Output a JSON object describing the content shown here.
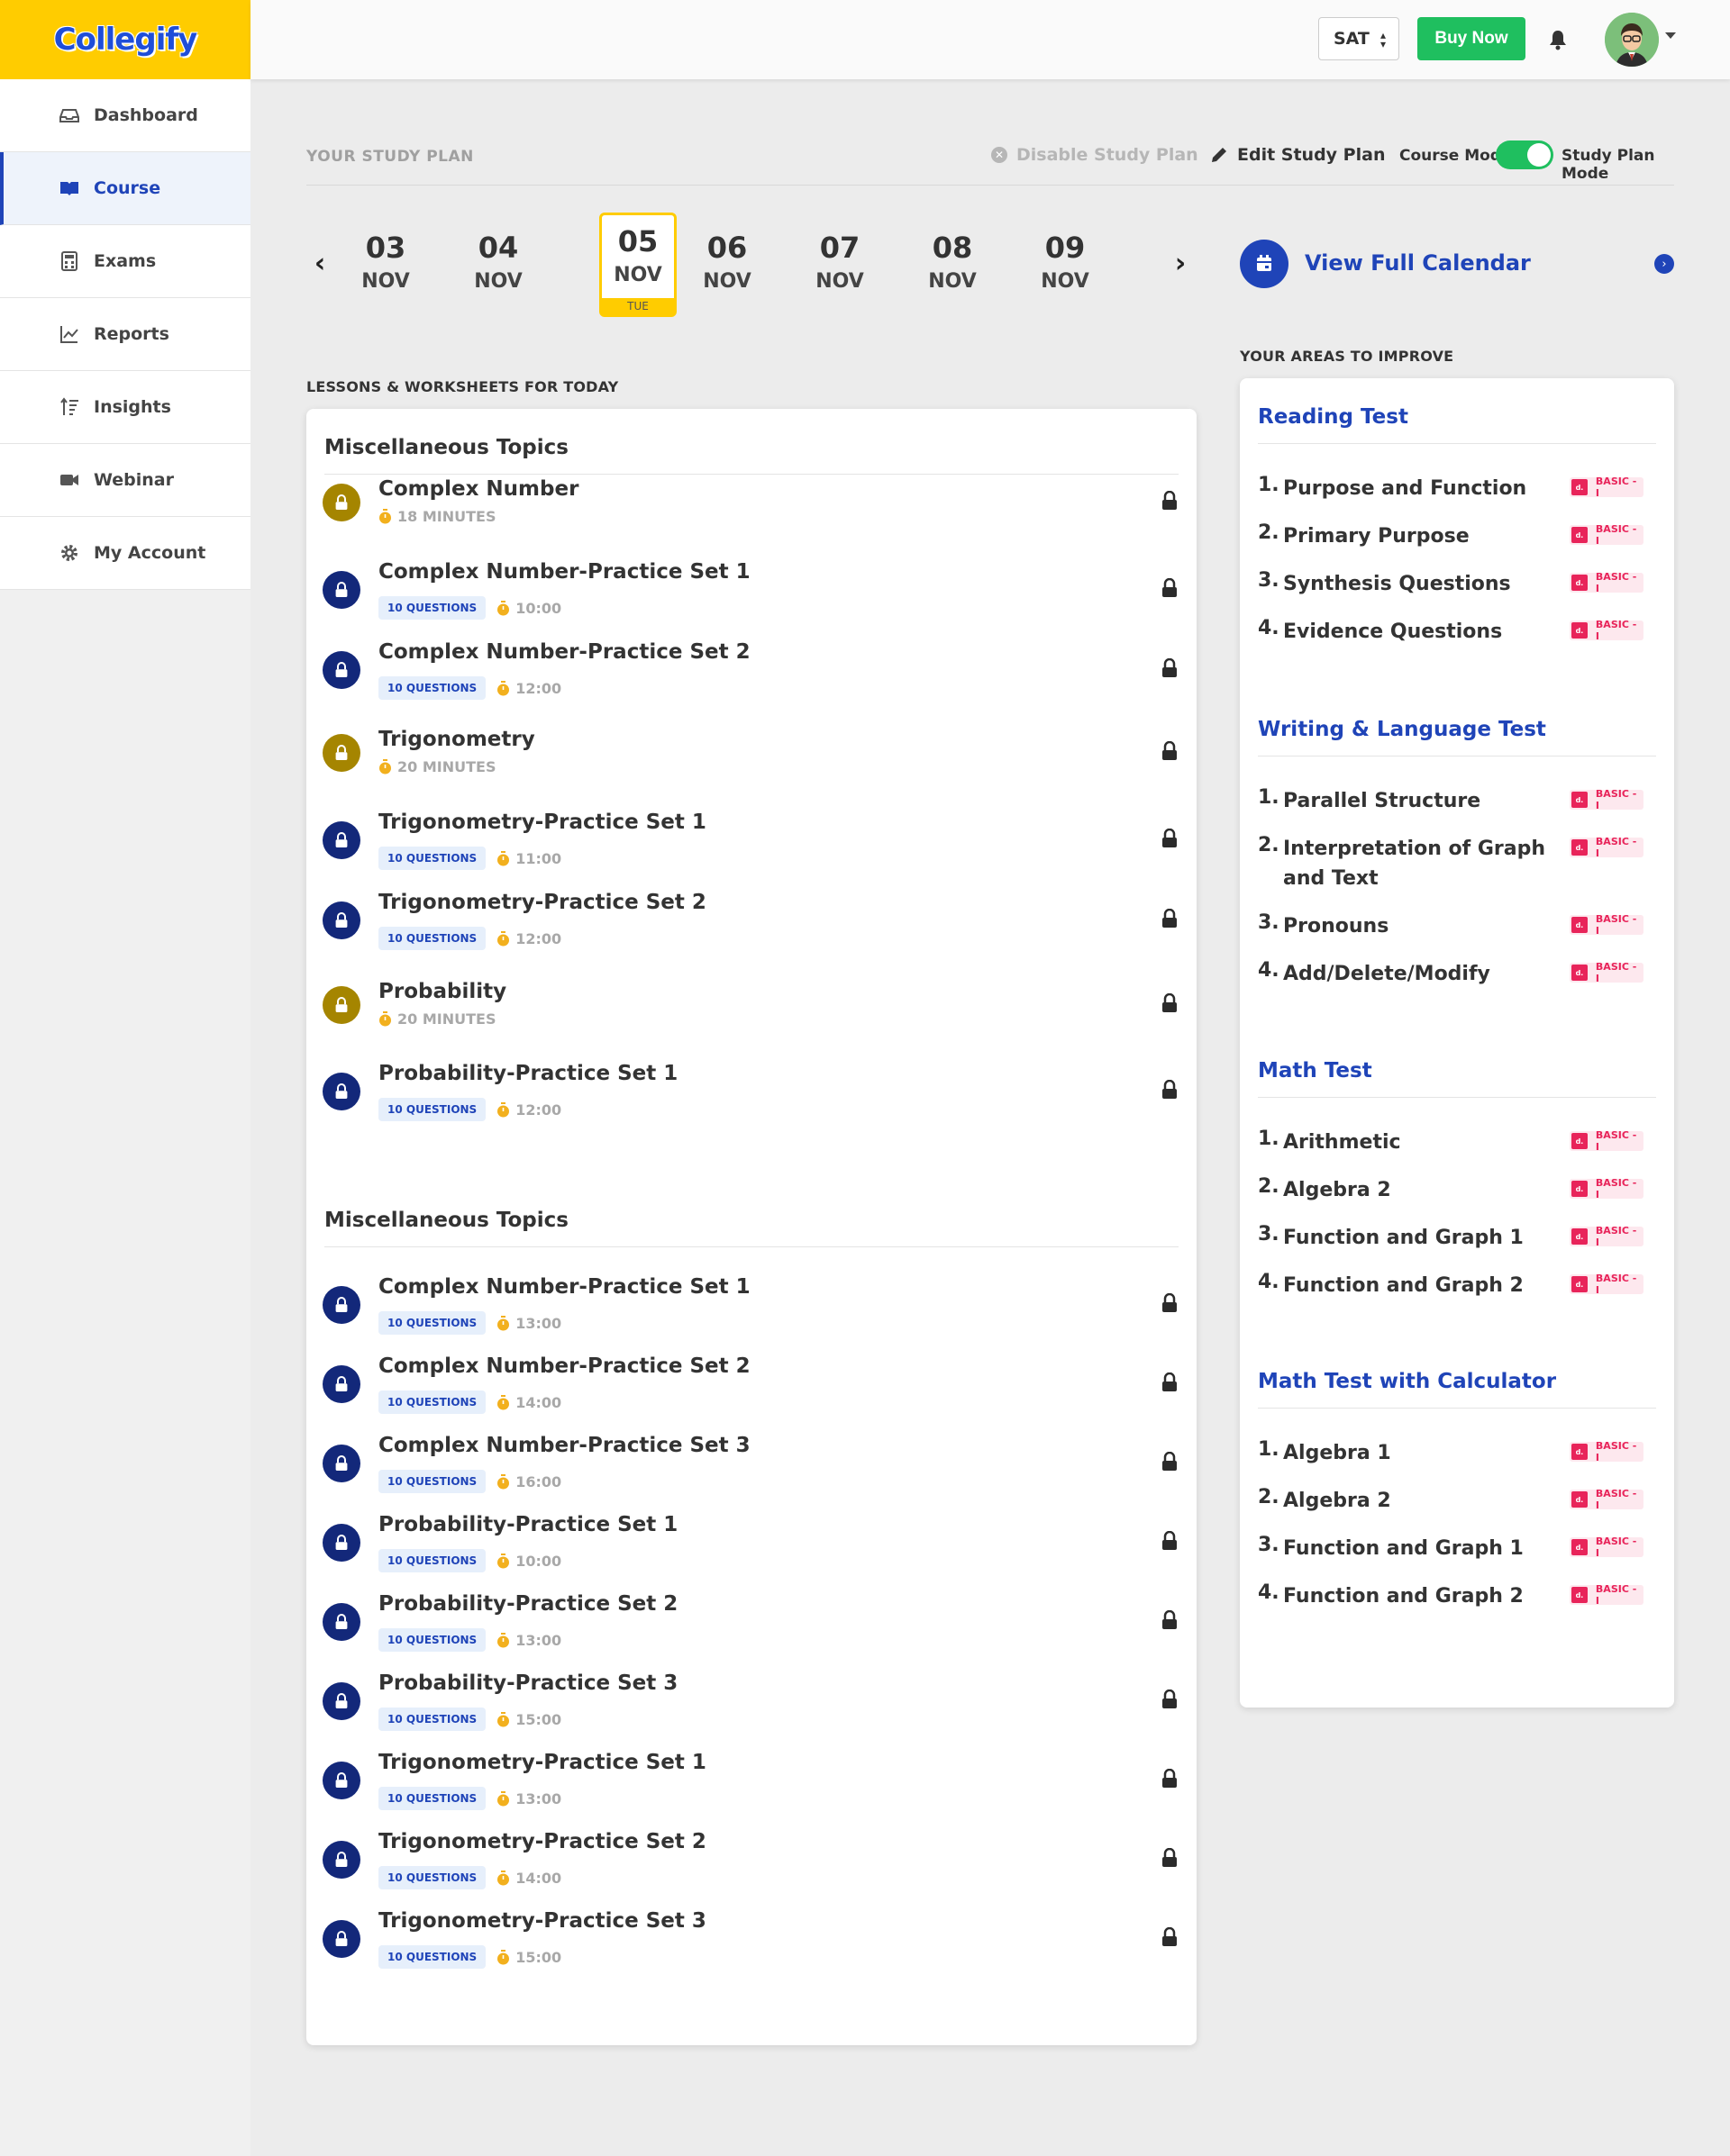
{
  "app": {
    "logo": "Collegify"
  },
  "sidebar": {
    "items": [
      {
        "label": "Dashboard",
        "icon": "inbox-icon"
      },
      {
        "label": "Course",
        "icon": "book-open-icon",
        "active": true
      },
      {
        "label": "Exams",
        "icon": "calculator-icon"
      },
      {
        "label": "Reports",
        "icon": "line-chart-icon"
      },
      {
        "label": "Insights",
        "icon": "sort-icon"
      },
      {
        "label": "Webinar",
        "icon": "video-camera-icon"
      },
      {
        "label": "My Account",
        "icon": "gear-icon"
      }
    ]
  },
  "topbar": {
    "exam_select": "SAT",
    "buy_label": "Buy Now",
    "bell_icon": "bell-icon",
    "avatar_icon": "avatar-icon"
  },
  "study_plan": {
    "title": "YOUR STUDY PLAN",
    "disable_label": "Disable Study Plan",
    "edit_label": "Edit Study Plan",
    "course_mode": "Course Mode",
    "plan_mode": "Study Plan Mode",
    "mode_on": true,
    "dates": [
      {
        "day": "03",
        "month": "NOV"
      },
      {
        "day": "04",
        "month": "NOV"
      },
      {
        "day": "05",
        "month": "NOV",
        "weekday": "TUE",
        "selected": true
      },
      {
        "day": "06",
        "month": "NOV"
      },
      {
        "day": "07",
        "month": "NOV"
      },
      {
        "day": "08",
        "month": "NOV"
      },
      {
        "day": "09",
        "month": "NOV"
      }
    ],
    "view_calendar": "View Full Calendar"
  },
  "lessons": {
    "section_label": "LESSONS & WORKSHEETS FOR TODAY",
    "groups": [
      {
        "title": "Miscellaneous Topics",
        "items": [
          {
            "title": "Complex Number",
            "type": "lesson",
            "time": "18 MINUTES"
          },
          {
            "title": "Complex Number-Practice Set 1",
            "type": "practice",
            "questions": "10 QUESTIONS",
            "time": "10:00"
          },
          {
            "title": "Complex Number-Practice Set 2",
            "type": "practice",
            "questions": "10 QUESTIONS",
            "time": "12:00"
          },
          {
            "title": "Trigonometry",
            "type": "lesson",
            "time": "20 MINUTES"
          },
          {
            "title": "Trigonometry-Practice Set 1",
            "type": "practice",
            "questions": "10 QUESTIONS",
            "time": "11:00"
          },
          {
            "title": "Trigonometry-Practice Set 2",
            "type": "practice",
            "questions": "10 QUESTIONS",
            "time": "12:00"
          },
          {
            "title": "Probability",
            "type": "lesson",
            "time": "20 MINUTES"
          },
          {
            "title": "Probability-Practice Set 1",
            "type": "practice",
            "questions": "10 QUESTIONS",
            "time": "12:00"
          }
        ]
      },
      {
        "title": "Miscellaneous Topics",
        "items": [
          {
            "title": "Complex Number-Practice Set 1",
            "type": "practice",
            "questions": "10 QUESTIONS",
            "time": "13:00"
          },
          {
            "title": "Complex Number-Practice Set 2",
            "type": "practice",
            "questions": "10 QUESTIONS",
            "time": "14:00"
          },
          {
            "title": "Complex Number-Practice Set 3",
            "type": "practice",
            "questions": "10 QUESTIONS",
            "time": "16:00"
          },
          {
            "title": "Probability-Practice Set 1",
            "type": "practice",
            "questions": "10 QUESTIONS",
            "time": "10:00"
          },
          {
            "title": "Probability-Practice Set 2",
            "type": "practice",
            "questions": "10 QUESTIONS",
            "time": "13:00"
          },
          {
            "title": "Probability-Practice Set 3",
            "type": "practice",
            "questions": "10 QUESTIONS",
            "time": "15:00"
          },
          {
            "title": "Trigonometry-Practice Set 1",
            "type": "practice",
            "questions": "10 QUESTIONS",
            "time": "13:00"
          },
          {
            "title": "Trigonometry-Practice Set 2",
            "type": "practice",
            "questions": "10 QUESTIONS",
            "time": "14:00"
          },
          {
            "title": "Trigonometry-Practice Set 3",
            "type": "practice",
            "questions": "10 QUESTIONS",
            "time": "15:00"
          }
        ]
      }
    ]
  },
  "areas": {
    "section_label": "YOUR AREAS TO IMPROVE",
    "badge_label": "BASIC - I",
    "badge_icon_text": "d.",
    "groups": [
      {
        "title": "Reading Test",
        "items": [
          "Purpose and Function",
          "Primary Purpose",
          "Synthesis Questions",
          "Evidence Questions"
        ]
      },
      {
        "title": "Writing & Language Test",
        "items": [
          "Parallel Structure",
          "Interpretation of Graph and Text",
          "Pronouns",
          "Add/Delete/Modify"
        ]
      },
      {
        "title": "Math Test",
        "items": [
          "Arithmetic",
          "Algebra 2",
          "Function and Graph 1",
          "Function and Graph 2"
        ]
      },
      {
        "title": "Math Test with Calculator",
        "items": [
          "Algebra 1",
          "Algebra 2",
          "Function and Graph 1",
          "Function and Graph 2"
        ]
      }
    ]
  },
  "colors": {
    "brand_yellow": "#ffcc00",
    "brand_blue": "#1f44b8",
    "buy_green": "#1fbf5f",
    "lesson_gold": "#a58500",
    "practice_navy": "#13287a",
    "badge_pink": "#e8245a"
  }
}
